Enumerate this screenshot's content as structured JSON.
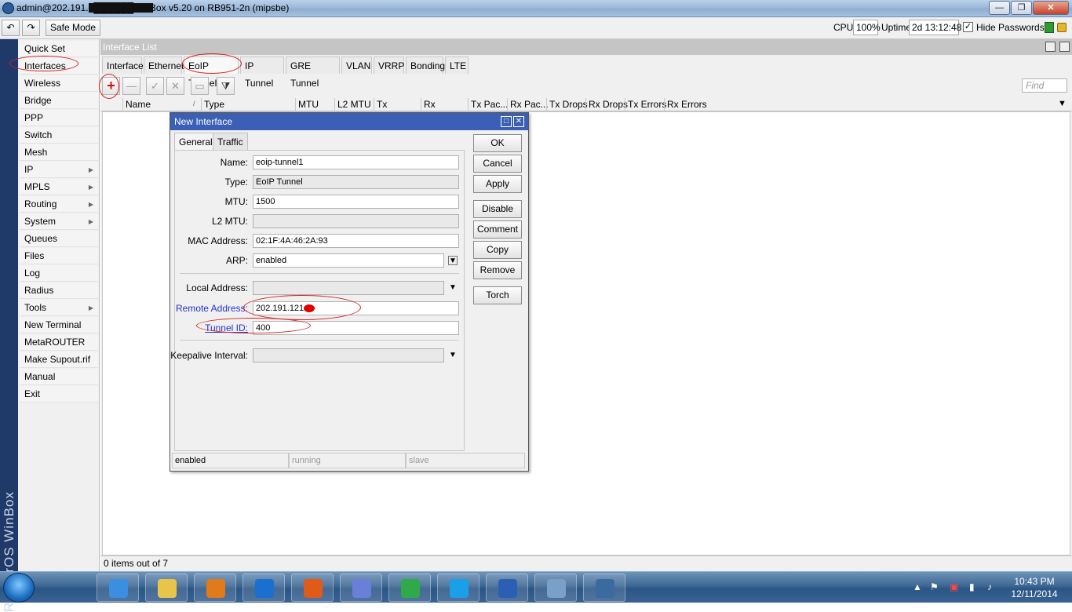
{
  "window": {
    "title": "admin@202.191.1██████WinBox v5.20 on RB951-2n (mipsbe)",
    "minimize_label": "—",
    "maximize_label": "❐",
    "close_label": "✕"
  },
  "toolbar": {
    "undo_label": "↶",
    "redo_label": "↷",
    "safe_mode_label": "Safe Mode",
    "cpu_label": "CPU:",
    "cpu_value": "100%",
    "uptime_label": "Uptime:",
    "uptime_value": "2d 13:12:48",
    "hide_passwords_checked": "✓",
    "hide_passwords_label": "Hide Passwords"
  },
  "brand": "RouterOS WinBox",
  "menu": {
    "items": [
      {
        "label": "Quick Set",
        "submenu": false
      },
      {
        "label": "Interfaces",
        "submenu": false
      },
      {
        "label": "Wireless",
        "submenu": false
      },
      {
        "label": "Bridge",
        "submenu": false
      },
      {
        "label": "PPP",
        "submenu": false
      },
      {
        "label": "Switch",
        "submenu": false
      },
      {
        "label": "Mesh",
        "submenu": false
      },
      {
        "label": "IP",
        "submenu": true
      },
      {
        "label": "MPLS",
        "submenu": true
      },
      {
        "label": "Routing",
        "submenu": true
      },
      {
        "label": "System",
        "submenu": true
      },
      {
        "label": "Queues",
        "submenu": false
      },
      {
        "label": "Files",
        "submenu": false
      },
      {
        "label": "Log",
        "submenu": false
      },
      {
        "label": "Radius",
        "submenu": false
      },
      {
        "label": "Tools",
        "submenu": true
      },
      {
        "label": "New Terminal",
        "submenu": false
      },
      {
        "label": "MetaROUTER",
        "submenu": false
      },
      {
        "label": "Make Supout.rif",
        "submenu": false
      },
      {
        "label": "Manual",
        "submenu": false
      },
      {
        "label": "Exit",
        "submenu": false
      }
    ],
    "submenu_arrow": "▶"
  },
  "interface_list": {
    "title": "Interface List",
    "tabs": [
      "Interface",
      "Ethernet",
      "EoIP Tunnel",
      "IP Tunnel",
      "GRE Tunnel",
      "VLAN",
      "VRRP",
      "Bonding",
      "LTE"
    ],
    "active_tab": "EoIP Tunnel",
    "buttons": {
      "add": "+",
      "remove": "—",
      "enable": "✓",
      "disable": "✕",
      "comment": "▭",
      "filter": "⧩"
    },
    "find_placeholder": "Find",
    "columns": [
      "Name",
      "Type",
      "MTU",
      "L2 MTU",
      "Tx",
      "Rx",
      "Tx Pac...",
      "Rx Pac...",
      "Tx Drops",
      "Rx Drops",
      "Tx Errors",
      "Rx Errors"
    ],
    "sort_indicator": "/",
    "status": "0 items out of 7"
  },
  "dialog": {
    "title": "New Interface",
    "tabs": [
      "General",
      "Traffic"
    ],
    "active_tab": "General",
    "fields": {
      "name": {
        "label": "Name:",
        "value": "eoip-tunnel1"
      },
      "type": {
        "label": "Type:",
        "value": "EoIP Tunnel"
      },
      "mtu": {
        "label": "MTU:",
        "value": "1500"
      },
      "l2mtu": {
        "label": "L2 MTU:",
        "value": ""
      },
      "mac": {
        "label": "MAC Address:",
        "value": "02:1F:4A:46:2A:93"
      },
      "arp": {
        "label": "ARP:",
        "value": "enabled"
      },
      "local": {
        "label": "Local Address:",
        "value": ""
      },
      "remote": {
        "label": "Remote Address:",
        "value": "202.191.121."
      },
      "tunnel_id": {
        "label": "Tunnel ID:",
        "value": "400"
      },
      "keepalive": {
        "label": "Keepalive Interval:",
        "value": ""
      }
    },
    "buttons": [
      "OK",
      "Cancel",
      "Apply",
      "Disable",
      "Comment",
      "Copy",
      "Remove",
      "Torch"
    ],
    "status": [
      "enabled",
      "running",
      "slave"
    ]
  },
  "colors": {
    "annotation": "#d52020",
    "dialog_title": "#3a5fb4",
    "link_label": "#2233cc"
  },
  "taskbar": {
    "clock_time": "10:43 PM",
    "clock_date": "12/11/2014",
    "apps": [
      "internet-explorer-icon",
      "file-explorer-icon",
      "media-player-icon",
      "remote-desktop-icon",
      "firefox-icon",
      "globe-icon",
      "chrome-icon",
      "skype-icon",
      "word-icon",
      "control-panel-icon",
      "winbox-icon"
    ]
  }
}
